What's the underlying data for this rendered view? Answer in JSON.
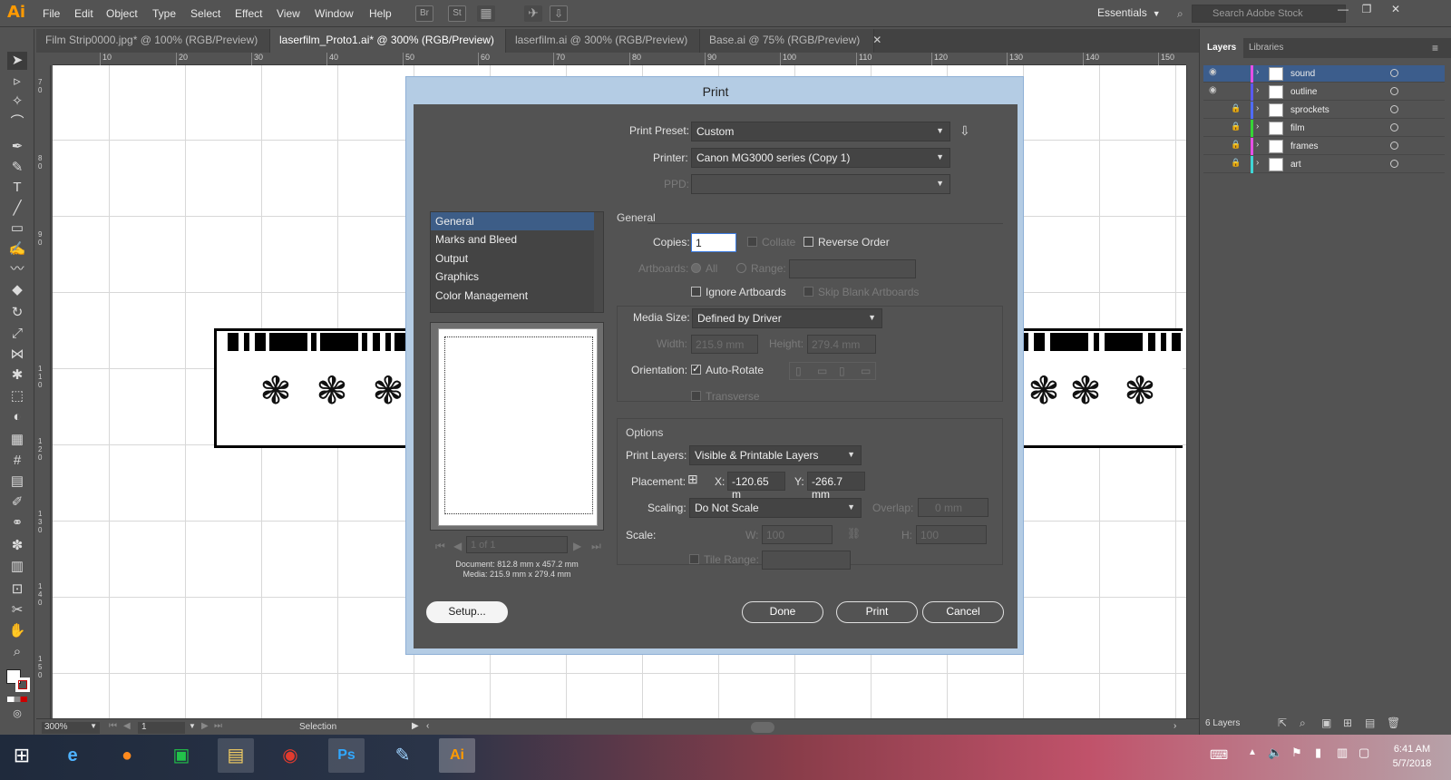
{
  "app": {
    "logo": "Ai",
    "menu": [
      "File",
      "Edit",
      "Object",
      "Type",
      "Select",
      "Effect",
      "View",
      "Window",
      "Help"
    ],
    "toolbar_icons": [
      "Br",
      "St"
    ],
    "workspace": "Essentials",
    "search_placeholder": "Search Adobe Stock"
  },
  "tabs": [
    {
      "label": "Film Strip0000.jpg* @ 100% (RGB/Preview)"
    },
    {
      "label": "laserfilm_Proto1.ai* @ 300% (RGB/Preview)"
    },
    {
      "label": "laserfilm.ai @ 300% (RGB/Preview)"
    },
    {
      "label": "Base.ai @ 75% (RGB/Preview)"
    }
  ],
  "ruler_top": [
    "10",
    "20",
    "30",
    "40",
    "50",
    "60",
    "70",
    "80",
    "90",
    "100",
    "110",
    "120",
    "130",
    "140",
    "150"
  ],
  "ruler_left": [
    "70",
    "80",
    "90",
    "110",
    "120",
    "130",
    "140",
    "150"
  ],
  "status": {
    "zoom": "300%",
    "artboard": "1",
    "tool": "Selection"
  },
  "layers_panel": {
    "tabs": [
      "Layers",
      "Libraries"
    ],
    "layers": [
      {
        "name": "sound",
        "color": "#e64fe6",
        "visible": true,
        "locked": false
      },
      {
        "name": "outline",
        "color": "#5a5af0",
        "visible": true,
        "locked": false
      },
      {
        "name": "sprockets",
        "color": "#4f6bff",
        "visible": false,
        "locked": true
      },
      {
        "name": "film",
        "color": "#36d436",
        "visible": false,
        "locked": true
      },
      {
        "name": "frames",
        "color": "#e64fe6",
        "visible": false,
        "locked": true
      },
      {
        "name": "art",
        "color": "#3fd6d6",
        "visible": false,
        "locked": true
      }
    ],
    "count": "6 Layers"
  },
  "dialog": {
    "title": "Print",
    "print_preset_label": "Print Preset:",
    "print_preset": "Custom",
    "printer_label": "Printer:",
    "printer": "Canon MG3000 series (Copy 1)",
    "ppd_label": "PPD:",
    "categories": [
      "General",
      "Marks and Bleed",
      "Output",
      "Graphics",
      "Color Management"
    ],
    "general_head": "General",
    "copies_label": "Copies:",
    "copies": "1",
    "collate": "Collate",
    "reverse_order": "Reverse Order",
    "artboards_label": "Artboards:",
    "all": "All",
    "range": "Range:",
    "ignore_artboards": "Ignore Artboards",
    "skip_blank": "Skip Blank Artboards",
    "media_size_label": "Media Size:",
    "media_size": "Defined by Driver",
    "width_label": "Width:",
    "width": "215.9 mm",
    "height_label": "Height:",
    "height": "279.4 mm",
    "orientation_label": "Orientation:",
    "auto_rotate": "Auto-Rotate",
    "transverse": "Transverse",
    "options_head": "Options",
    "print_layers_label": "Print Layers:",
    "print_layers": "Visible & Printable Layers",
    "placement_label": "Placement:",
    "x_label": "X:",
    "x": "-120.65 m",
    "y_label": "Y:",
    "y": "-266.7 mm",
    "scaling_label": "Scaling:",
    "scaling": "Do Not Scale",
    "overlap_label": "Overlap:",
    "overlap": "0 mm",
    "scale_label": "Scale:",
    "w_label": "W:",
    "w": "100",
    "h_label": "H:",
    "h": "100",
    "tile_range": "Tile Range:",
    "page_nav": "1 of 1",
    "document_info": "Document: 812.8 mm x 457.2 mm",
    "media_info": "Media: 215.9 mm x 279.4 mm",
    "setup_btn": "Setup...",
    "done_btn": "Done",
    "print_btn": "Print",
    "cancel_btn": "Cancel"
  },
  "taskbar": {
    "time": "6:41 AM",
    "date": "5/7/2018",
    "apps": [
      "windows-start",
      "internet-explorer",
      "firefox",
      "store",
      "file-explorer",
      "chrome",
      "photoshop",
      "paint",
      "illustrator"
    ]
  }
}
